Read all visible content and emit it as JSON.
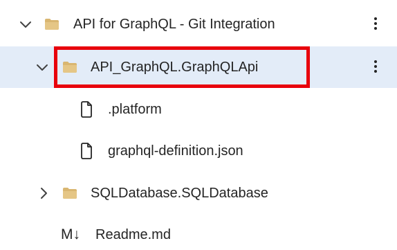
{
  "tree": {
    "root": {
      "label": "API for GraphQL - Git Integration",
      "expanded": true,
      "icon": "folder-icon"
    },
    "graphql_folder": {
      "label": "API_GraphQL.GraphQLApi",
      "expanded": true,
      "selected": true,
      "icon": "folder-icon"
    },
    "platform_file": {
      "label": ".platform",
      "icon": "file-icon"
    },
    "graphql_definition_file": {
      "label": "graphql-definition.json",
      "icon": "file-icon"
    },
    "sql_folder": {
      "label": "SQLDatabase.SQLDatabase",
      "expanded": false,
      "icon": "folder-icon"
    },
    "readme_file": {
      "label": "Readme.md",
      "icon_glyph": "M↓",
      "icon": "markdown-icon"
    }
  },
  "colors": {
    "selected_row": "#e3ecf8",
    "highlight_border": "#e8000c",
    "folder": "#d9b671"
  }
}
